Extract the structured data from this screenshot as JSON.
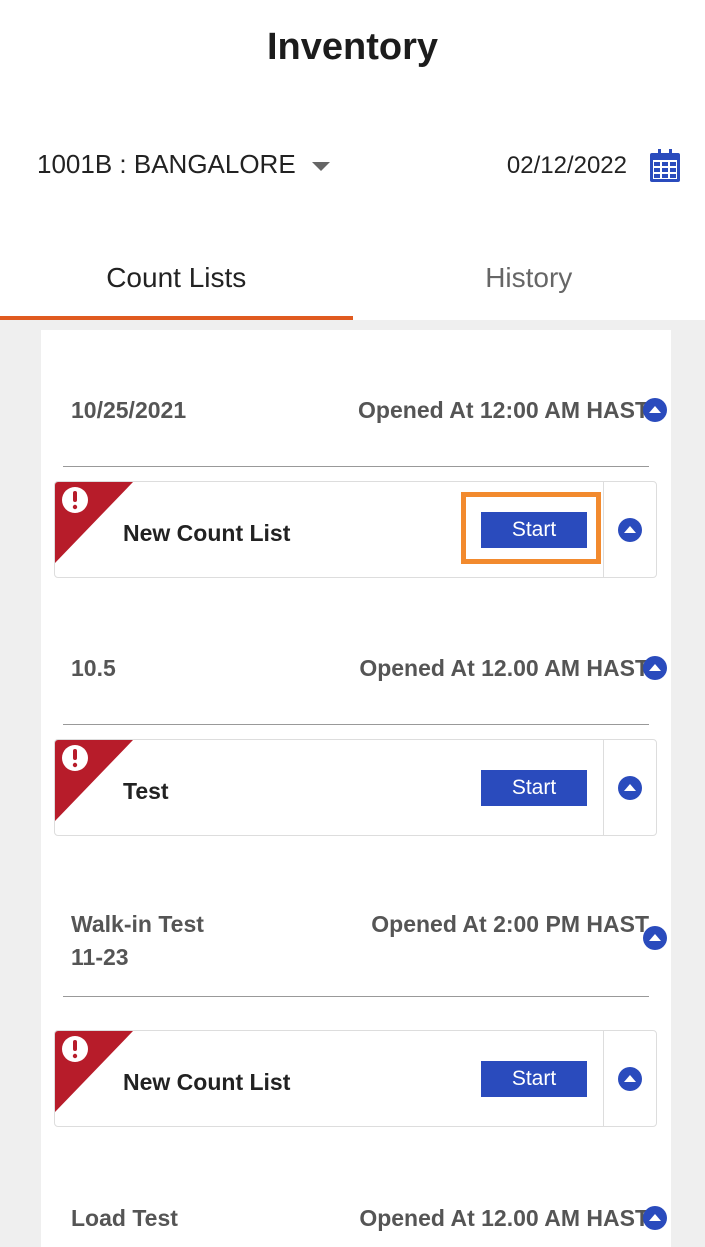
{
  "header": {
    "title": "Inventory"
  },
  "store": {
    "label": "1001B : BANGALORE"
  },
  "date": {
    "value": "02/12/2022"
  },
  "tabs": [
    {
      "label": "Count Lists",
      "active": true
    },
    {
      "label": "History",
      "active": false
    }
  ],
  "groups": [
    {
      "name": "10/25/2021",
      "opened": "Opened At 12:00 AM HAST",
      "item": {
        "name": "New Count List",
        "start_label": "Start"
      }
    },
    {
      "name": "10.5",
      "opened": "Opened At 12.00 AM HAST",
      "item": {
        "name": "Test",
        "start_label": "Start"
      }
    },
    {
      "name": "Walk-in Test 11-23",
      "opened": "Opened At 2:00 PM HAST",
      "item": {
        "name": "New Count List",
        "start_label": "Start"
      }
    },
    {
      "name": "Load Test",
      "opened": "Opened At 12.00 AM HAST"
    }
  ],
  "colors": {
    "accent": "#e05a1f",
    "primary": "#2a4bbd",
    "flag": "#b71c2a",
    "highlight": "#f28a2e"
  },
  "icons": {
    "store_caret": "chevron-down-icon",
    "calendar": "calendar-icon",
    "toggle": "chevron-up-icon",
    "flag": "alert-icon"
  }
}
